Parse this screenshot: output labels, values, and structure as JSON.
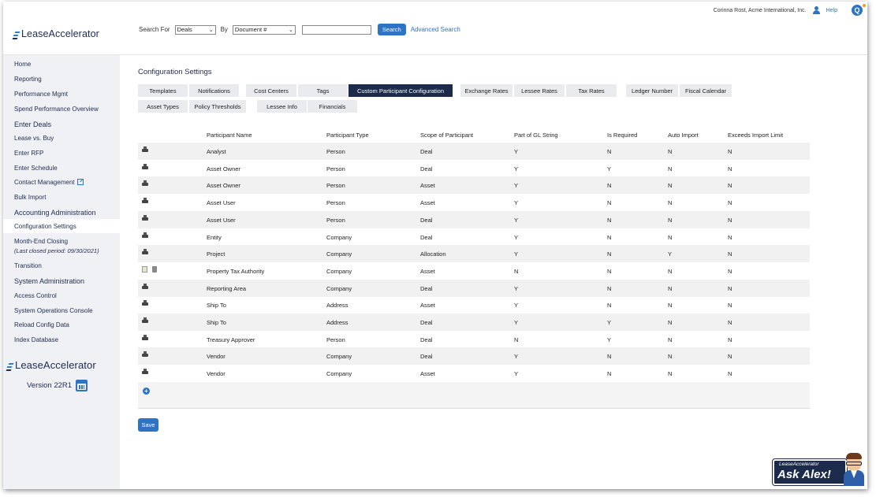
{
  "app": {
    "logo_text": "LeaseAccelerator"
  },
  "header": {
    "search_for_label": "Search For",
    "search_for_value": "Deals",
    "by_label": "By",
    "by_value": "Document #",
    "search_input_value": "",
    "search_button": "Search",
    "advanced_search": "Advanced Search",
    "user": "Corinna Rost, Acme International, Inc.",
    "help": "Help"
  },
  "sidebar": {
    "items": [
      {
        "label": "Home"
      },
      {
        "label": "Reporting"
      },
      {
        "label": "Performance Mgmt"
      },
      {
        "label": "Spend Performance Overview"
      }
    ],
    "enter_deals": {
      "heading": "Enter Deals",
      "items": [
        {
          "label": "Lease vs. Buy"
        },
        {
          "label": "Enter RFP"
        },
        {
          "label": "Enter Schedule"
        },
        {
          "label": "Contact Management"
        },
        {
          "label": "Bulk Import"
        }
      ]
    },
    "accounting": {
      "heading": "Accounting Administration",
      "items": [
        {
          "label": "Configuration Settings"
        },
        {
          "label": "Month-End Closing"
        },
        {
          "label": "Transition"
        }
      ],
      "closing_note": "(Last closed period: 09/30/2021)"
    },
    "system": {
      "heading": "System Administration",
      "items": [
        {
          "label": "Access Control"
        },
        {
          "label": "System Operations Console"
        },
        {
          "label": "Reload Config Data"
        },
        {
          "label": "Index Database"
        }
      ]
    },
    "version": "Version 22R1"
  },
  "main": {
    "title": "Configuration Settings",
    "tabs_row1": [
      "Templates",
      "Notifications",
      "Cost Centers",
      "Tags",
      "Custom Participant Configuration",
      "Exchange Rates",
      "Lessee Rates",
      "Tax Rates",
      "Ledger Number",
      "Fiscal Calendar"
    ],
    "tabs_row2": [
      "Asset Types",
      "Policy Thresholds",
      "Lessee Info",
      "Financials"
    ],
    "active_tab": "Custom Participant Configuration",
    "columns": [
      "Participant Name",
      "Participant Type",
      "Scope of Participant",
      "Part of GL String",
      "Is Required",
      "Auto Import",
      "Exceeds Import Limit"
    ],
    "rows": [
      {
        "icon": "print",
        "name": "Analyst",
        "type": "Person",
        "scope": "Deal",
        "gl": "Y",
        "required": "N",
        "auto": "N",
        "exceeds": "N"
      },
      {
        "icon": "print",
        "name": "Asset Owner",
        "type": "Person",
        "scope": "Deal",
        "gl": "Y",
        "required": "Y",
        "auto": "N",
        "exceeds": "N"
      },
      {
        "icon": "print",
        "name": "Asset Owner",
        "type": "Person",
        "scope": "Asset",
        "gl": "Y",
        "required": "N",
        "auto": "N",
        "exceeds": "N"
      },
      {
        "icon": "print",
        "name": "Asset User",
        "type": "Person",
        "scope": "Asset",
        "gl": "Y",
        "required": "N",
        "auto": "N",
        "exceeds": "N"
      },
      {
        "icon": "print",
        "name": "Asset User",
        "type": "Person",
        "scope": "Deal",
        "gl": "Y",
        "required": "N",
        "auto": "N",
        "exceeds": "N"
      },
      {
        "icon": "print",
        "name": "Entity",
        "type": "Company",
        "scope": "Deal",
        "gl": "Y",
        "required": "N",
        "auto": "N",
        "exceeds": "N"
      },
      {
        "icon": "print",
        "name": "Project",
        "type": "Company",
        "scope": "Allocation",
        "gl": "Y",
        "required": "N",
        "auto": "Y",
        "exceeds": "N"
      },
      {
        "icon": "edit",
        "name": "Property Tax Authority",
        "type": "Company",
        "scope": "Asset",
        "gl": "N",
        "required": "N",
        "auto": "N",
        "exceeds": "N"
      },
      {
        "icon": "print",
        "name": "Reporting Area",
        "type": "Company",
        "scope": "Deal",
        "gl": "Y",
        "required": "N",
        "auto": "N",
        "exceeds": "N"
      },
      {
        "icon": "print",
        "name": "Ship To",
        "type": "Address",
        "scope": "Asset",
        "gl": "Y",
        "required": "N",
        "auto": "N",
        "exceeds": "N"
      },
      {
        "icon": "print",
        "name": "Ship To",
        "type": "Address",
        "scope": "Deal",
        "gl": "Y",
        "required": "Y",
        "auto": "N",
        "exceeds": "N"
      },
      {
        "icon": "print",
        "name": "Treasury Approver",
        "type": "Person",
        "scope": "Deal",
        "gl": "N",
        "required": "Y",
        "auto": "N",
        "exceeds": "N"
      },
      {
        "icon": "print",
        "name": "Vendor",
        "type": "Company",
        "scope": "Deal",
        "gl": "Y",
        "required": "N",
        "auto": "N",
        "exceeds": "N"
      },
      {
        "icon": "print",
        "name": "Vendor",
        "type": "Company",
        "scope": "Asset",
        "gl": "Y",
        "required": "N",
        "auto": "N",
        "exceeds": "N"
      }
    ],
    "save_button": "Save"
  },
  "ask_alex": {
    "small": "LeaseAccelerator",
    "big": "Ask Alex!"
  },
  "colors": {
    "accent": "#2e73c4",
    "navy": "#1c2b4c",
    "sidebar_bg": "#f0f1f5"
  }
}
